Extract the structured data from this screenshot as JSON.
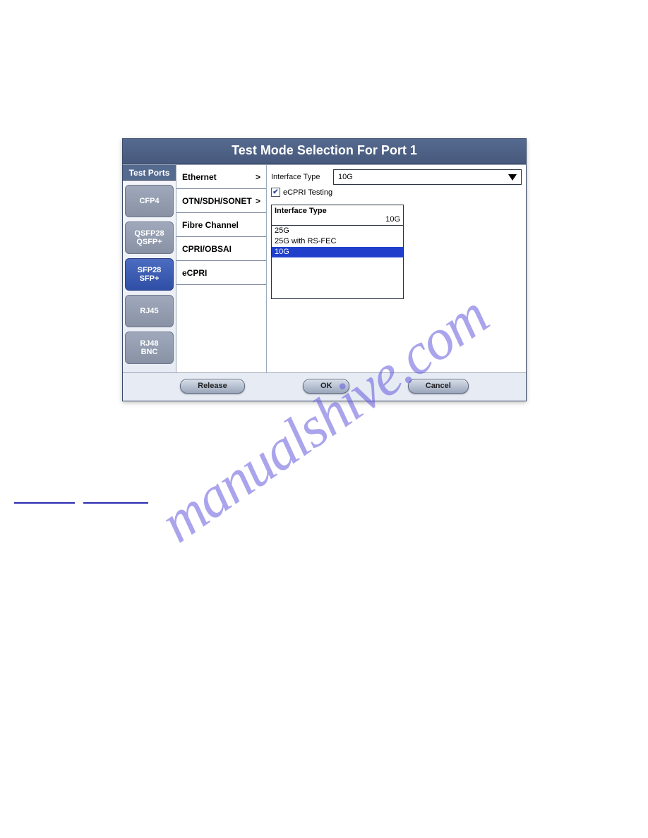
{
  "watermark": "manualshive.com",
  "title": "Test Mode Selection For Port 1",
  "sidebar": {
    "header": "Test Ports",
    "items": [
      {
        "label": "CFP4",
        "sub": ""
      },
      {
        "label": "QSFP28",
        "sub": "QSFP+"
      },
      {
        "label": "SFP28",
        "sub": "SFP+"
      },
      {
        "label": "RJ45",
        "sub": ""
      },
      {
        "label": "RJ48",
        "sub": "BNC"
      }
    ]
  },
  "tests": [
    {
      "label": "Ethernet",
      "submenu": true
    },
    {
      "label": "OTN/SDH/SONET",
      "submenu": true
    },
    {
      "label": "Fibre Channel",
      "submenu": false
    },
    {
      "label": "CPRI/OBSAI",
      "submenu": false
    },
    {
      "label": "eCPRI",
      "submenu": false
    }
  ],
  "config": {
    "interface_type_label": "Interface Type",
    "interface_type_value": "10G",
    "ecpri_label": "eCPRI Testing",
    "ecpri_checked": true
  },
  "dropdown": {
    "header": "Interface Type",
    "current": "10G",
    "options": [
      {
        "label": "25G",
        "selected": false
      },
      {
        "label": "25G with RS-FEC",
        "selected": false
      },
      {
        "label": "10G",
        "selected": true
      }
    ]
  },
  "buttons": {
    "release": "Release",
    "ok": "OK",
    "cancel": "Cancel"
  }
}
